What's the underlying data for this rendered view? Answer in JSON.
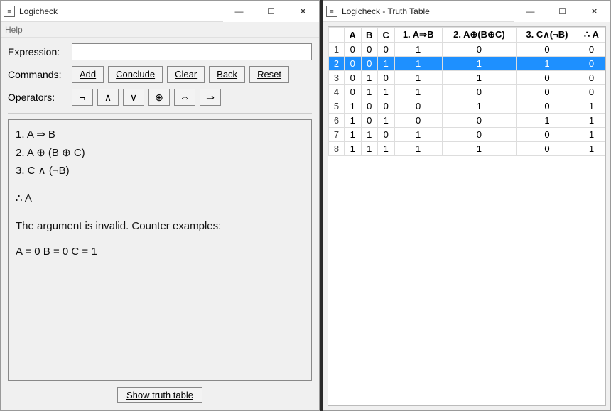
{
  "left": {
    "title": "Logicheck",
    "menu_help": "Help",
    "expression_label": "Expression:",
    "expression_value": "",
    "commands_label": "Commands:",
    "buttons": {
      "add": "Add",
      "conclude": "Conclude",
      "clear": "Clear",
      "back": "Back",
      "reset": "Reset"
    },
    "operators_label": "Operators:",
    "operators": [
      "¬",
      "∧",
      "∨",
      "⊕",
      "⇔",
      "⇒"
    ],
    "output": {
      "premises": [
        "1. A ⇒ B",
        "2. A ⊕ (B ⊕ C)",
        "3. C ∧ (¬B)"
      ],
      "conclusion": "∴  A",
      "verdict": "The argument is invalid. Counter examples:",
      "counter": "A = 0  B = 0  C = 1"
    },
    "show_truth_table": "Show truth table"
  },
  "right": {
    "title": "Logicheck - Truth Table",
    "columns": [
      "",
      "A",
      "B",
      "C",
      "1.  A⇒B",
      "2.  A⊕(B⊕C)",
      "3.  C∧(¬B)",
      "∴  A"
    ],
    "selected_row": 2,
    "rows": [
      [
        1,
        0,
        0,
        0,
        1,
        0,
        0,
        0
      ],
      [
        2,
        0,
        0,
        1,
        1,
        1,
        1,
        0
      ],
      [
        3,
        0,
        1,
        0,
        1,
        1,
        0,
        0
      ],
      [
        4,
        0,
        1,
        1,
        1,
        0,
        0,
        0
      ],
      [
        5,
        1,
        0,
        0,
        0,
        1,
        0,
        1
      ],
      [
        6,
        1,
        0,
        1,
        0,
        0,
        1,
        1
      ],
      [
        7,
        1,
        1,
        0,
        1,
        0,
        0,
        1
      ],
      [
        8,
        1,
        1,
        1,
        1,
        1,
        0,
        1
      ]
    ]
  }
}
